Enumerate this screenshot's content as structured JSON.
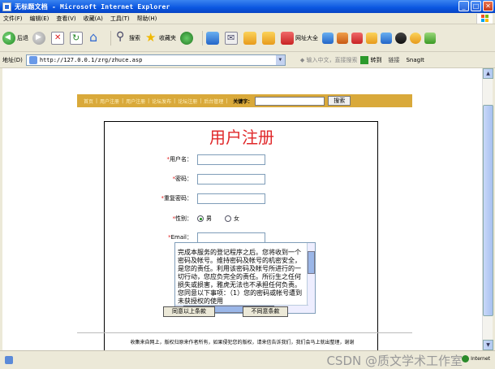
{
  "window": {
    "title": "无标题文档 - Microsoft Internet Explorer"
  },
  "menu": [
    "文件(F)",
    "编辑(E)",
    "查看(V)",
    "收藏(A)",
    "工具(T)",
    "帮助(H)"
  ],
  "toolbar": {
    "back_label": "后退",
    "search_label": "搜索",
    "favorites_label": "收藏夹",
    "sites_label": "网址大全"
  },
  "address": {
    "label": "地址(D)",
    "url": "http://127.0.0.1/zrg/zhuce.asp",
    "hint": "◆ 输入中文，直接搜索",
    "go_label": "转到",
    "links_label": "链接",
    "snagit_label": "SnagIt"
  },
  "nav": {
    "items": [
      "首页",
      "用户注册",
      "用户注册",
      "论坛发布",
      "论坛注册",
      "后台管理"
    ],
    "keyword_label": "关键字：",
    "search_button": "搜索"
  },
  "form": {
    "title": "用户注册",
    "fields": {
      "username_label": "用户名：",
      "password_label": "密码：",
      "confirm_label": "重复密码：",
      "gender_label": "性别：",
      "gender_male": "男",
      "gender_female": "女",
      "email_label": "Email："
    },
    "required_mark": "*",
    "terms_text": "完成本服务的登记程序之后。您将收到一个密码及帐号。维持密码及帐号的机密安全，是您的责任。利用该密码及帐号所进行的一切行动，您应负完全的责任。所衍生之任何损失或损害，雅虎无法也不承担任何负责。您同意以下事项：（1）您的密码或帐号遭到未获授权的使用",
    "agree_button": "同意以上条款",
    "disagree_button": "不同意条款"
  },
  "footer": {
    "text": "收集来自网上，版权归原来作者所有，如果侵犯您的版权，请来信告诉我们，我们会马上就出整理，谢谢"
  },
  "status": {
    "watermark": "CSDN @质文学术工作室",
    "zone": "Internet"
  }
}
